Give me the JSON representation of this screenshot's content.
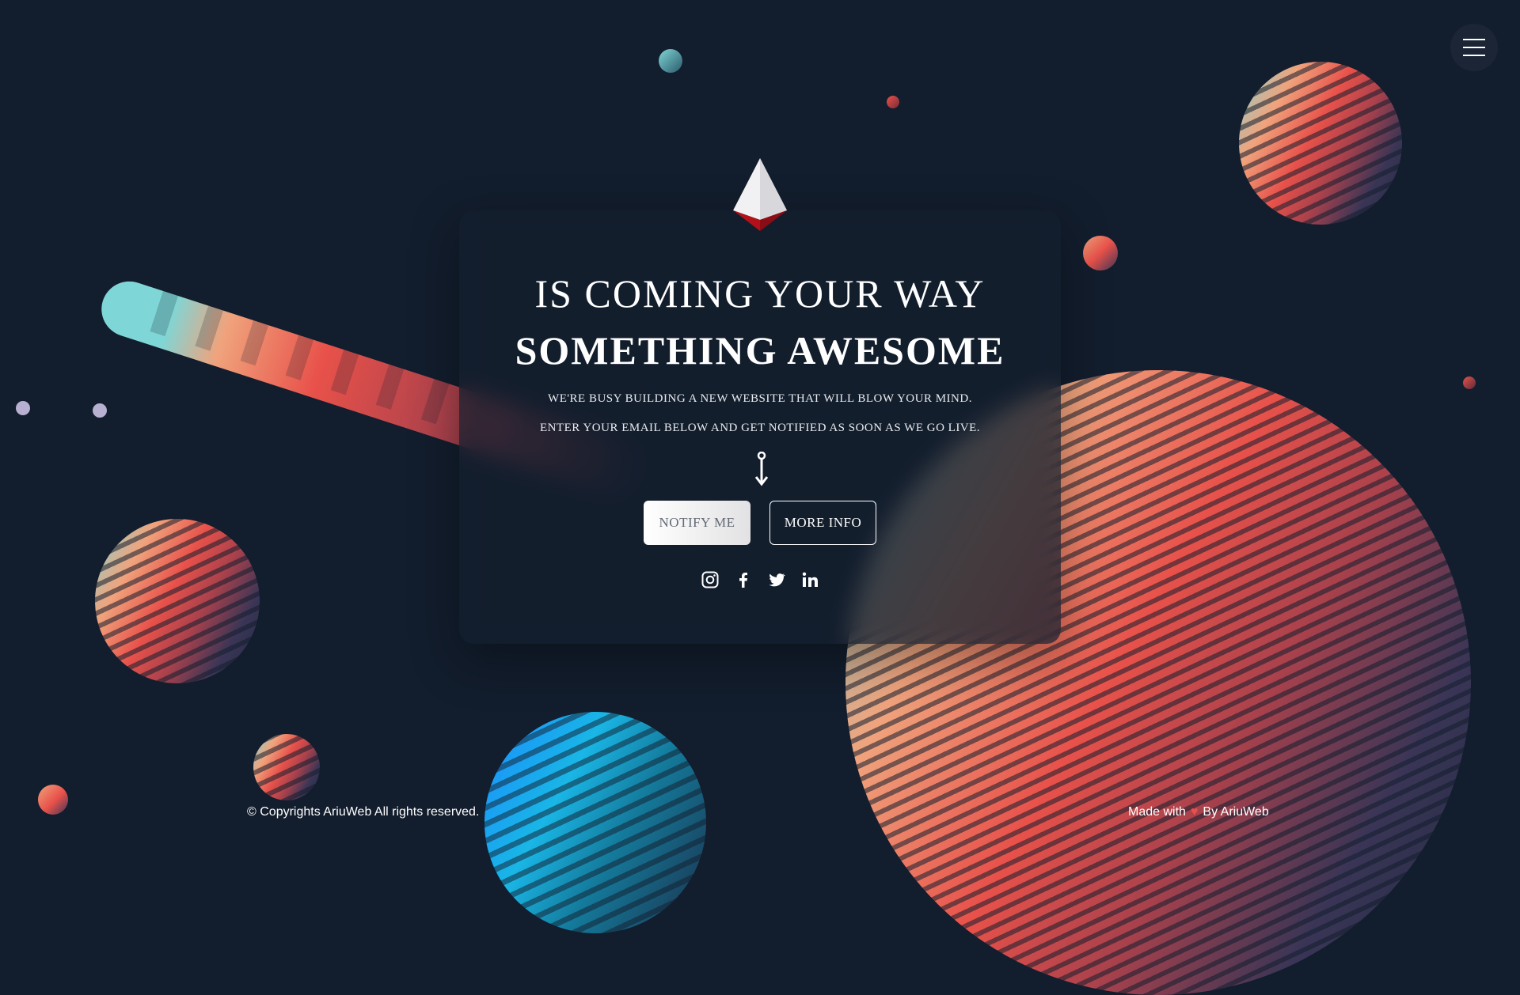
{
  "hero": {
    "title_line1": "IS COMING YOUR WAY",
    "title_line2": "SOMETHING AWESOME",
    "subtitle_line1": "WE'RE BUSY BUILDING A NEW WEBSITE THAT WILL BLOW YOUR MIND.",
    "subtitle_line2": "ENTER YOUR EMAIL BELOW AND GET NOTIFIED AS SOON AS WE GO LIVE."
  },
  "buttons": {
    "notify_label": "NOTIFY ME",
    "more_info_label": "MORE INFO"
  },
  "social": [
    "instagram-icon",
    "facebook-icon",
    "twitter-icon",
    "linkedin-icon"
  ],
  "footer": {
    "copyright": "© Copyrights AriuWeb All rights reserved.",
    "made_with_prefix": "Made with",
    "made_with_suffix": "By AriuWeb"
  },
  "colors": {
    "background": "#121d2d",
    "accent_red": "#e8514a",
    "accent_teal": "#7fd6d6",
    "accent_peach": "#f0a37c"
  }
}
